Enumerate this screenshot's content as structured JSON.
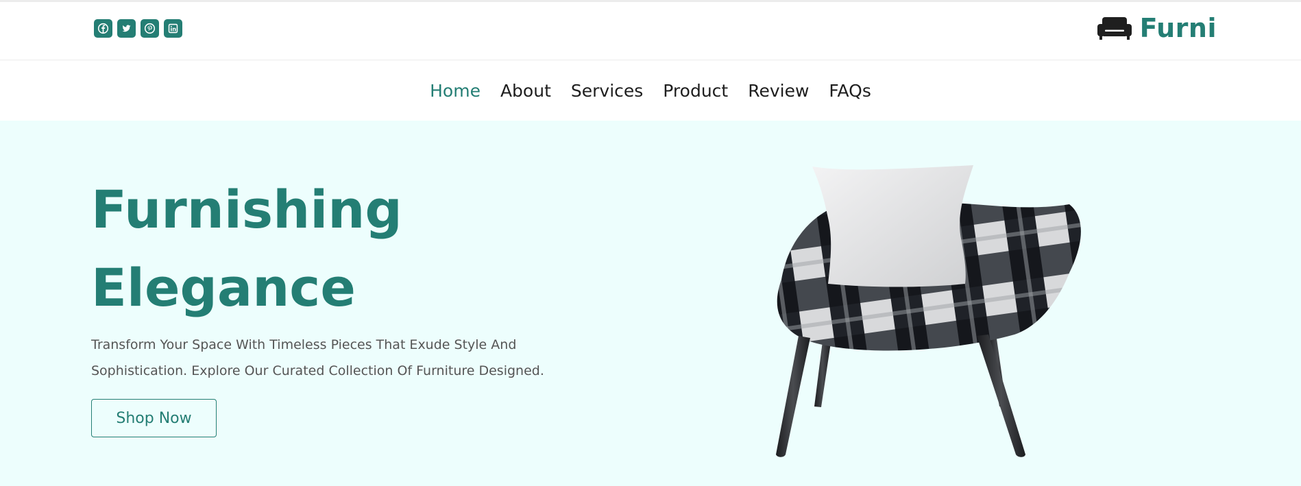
{
  "brand": {
    "name": "Furni",
    "icon": "sofa-icon",
    "color": "#247e74"
  },
  "socials": [
    {
      "icon": "facebook-icon"
    },
    {
      "icon": "twitter-icon"
    },
    {
      "icon": "pinterest-icon"
    },
    {
      "icon": "linkedin-icon"
    }
  ],
  "nav": {
    "items": [
      {
        "label": "Home",
        "active": true
      },
      {
        "label": "About",
        "active": false
      },
      {
        "label": "Services",
        "active": false
      },
      {
        "label": "Product",
        "active": false
      },
      {
        "label": "Review",
        "active": false
      },
      {
        "label": "FAQs",
        "active": false
      }
    ]
  },
  "hero": {
    "title_line1": "Furnishing",
    "title_line2": "Elegance",
    "description_line1": "Transform Your Space With Timeless Pieces That Exude Style And",
    "description_line2": "Sophistication. Explore Our Curated Collection Of Furniture Designed.",
    "cta_label": "Shop Now",
    "background": "#edfefd",
    "image": "plaid-armchair-with-pillow"
  }
}
